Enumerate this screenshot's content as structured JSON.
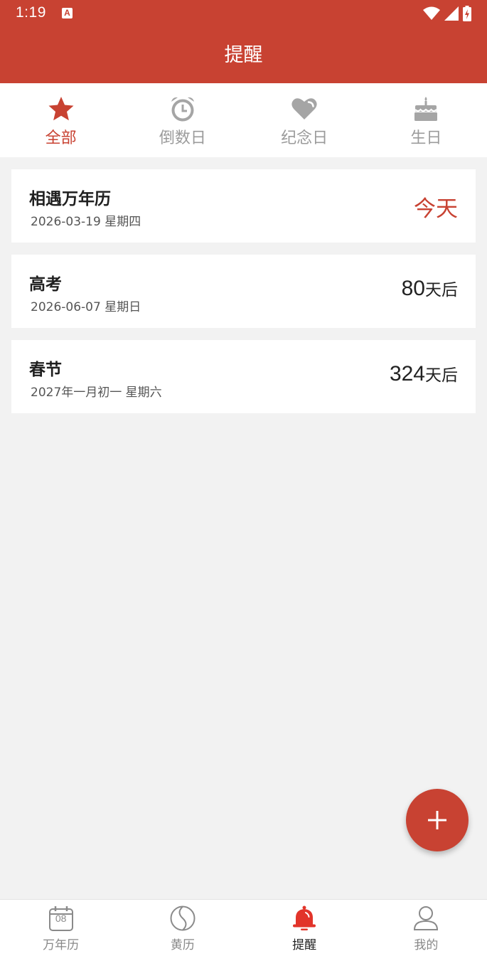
{
  "status_bar": {
    "time": "1:19",
    "app_icon_letter": "A"
  },
  "header": {
    "title": "提醒"
  },
  "tabs": [
    {
      "label": "全部",
      "icon": "star-icon",
      "active": true
    },
    {
      "label": "倒数日",
      "icon": "alarm-clock-icon",
      "active": false
    },
    {
      "label": "纪念日",
      "icon": "heart-icon",
      "active": false
    },
    {
      "label": "生日",
      "icon": "birthday-cake-icon",
      "active": false
    }
  ],
  "reminders": [
    {
      "title": "相遇万年历",
      "date": "2026-03-19 星期四",
      "count": "今天",
      "unit": ""
    },
    {
      "title": "高考",
      "date": "2026-06-07 星期日",
      "count": "80",
      "unit": "天后"
    },
    {
      "title": "春节",
      "date": "2027年一月初一 星期六",
      "count": "324",
      "unit": "天后"
    }
  ],
  "fab": {
    "icon": "plus-icon"
  },
  "bottom_nav": [
    {
      "label": "万年历",
      "icon": "calendar-icon",
      "calendar_day": "08",
      "active": false
    },
    {
      "label": "黄历",
      "icon": "yin-yang-icon",
      "active": false
    },
    {
      "label": "提醒",
      "icon": "bell-icon",
      "active": true
    },
    {
      "label": "我的",
      "icon": "user-icon",
      "active": false
    }
  ],
  "colors": {
    "primary": "#c84232",
    "inactive": "#9b9b9b",
    "background": "#f2f2f2"
  }
}
